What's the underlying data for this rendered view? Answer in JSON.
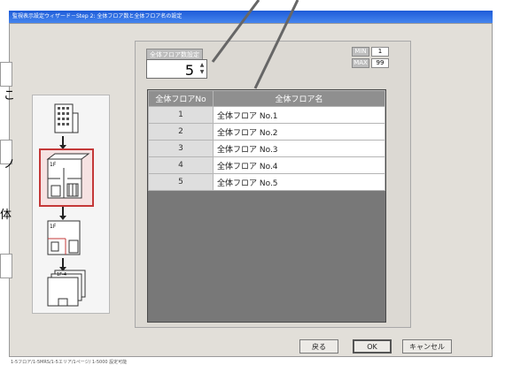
{
  "window": {
    "title": "監視表示設定ウィザード－Step 2: 全体フロア数と全体フロア名の設定",
    "status_text": "1-5フロア/1-5MRS/1-5エリア/1ページ/ 1-5000 設定可能"
  },
  "left_edge": {
    "char_1": "こ",
    "char_2": "ノ",
    "char_3": "体"
  },
  "settings": {
    "floor_count_label": "全体フロア数設定",
    "floor_count_value": "5",
    "min_label": "MIN",
    "min_value": "1",
    "max_label": "MAX",
    "max_value": "99"
  },
  "table": {
    "headers": {
      "no": "全体フロアNo",
      "name": "全体フロア名"
    },
    "rows": [
      {
        "no": "1",
        "name": "全体フロア No.1"
      },
      {
        "no": "2",
        "name": "全体フロア No.2"
      },
      {
        "no": "3",
        "name": "全体フロア No.3"
      },
      {
        "no": "4",
        "name": "全体フロア No.4"
      },
      {
        "no": "5",
        "name": "全体フロア No.5"
      }
    ]
  },
  "icons": {
    "step1_label": "",
    "step2_label": "1F",
    "step3_label": "1F",
    "step4_label": "1F-4"
  },
  "buttons": {
    "back": "戻る",
    "ok": "OK",
    "cancel": "キャンセル"
  },
  "colors": {
    "title_bar": "#1e5cd8",
    "selection_border": "#c43838",
    "table_header": "#8f8f8f"
  }
}
